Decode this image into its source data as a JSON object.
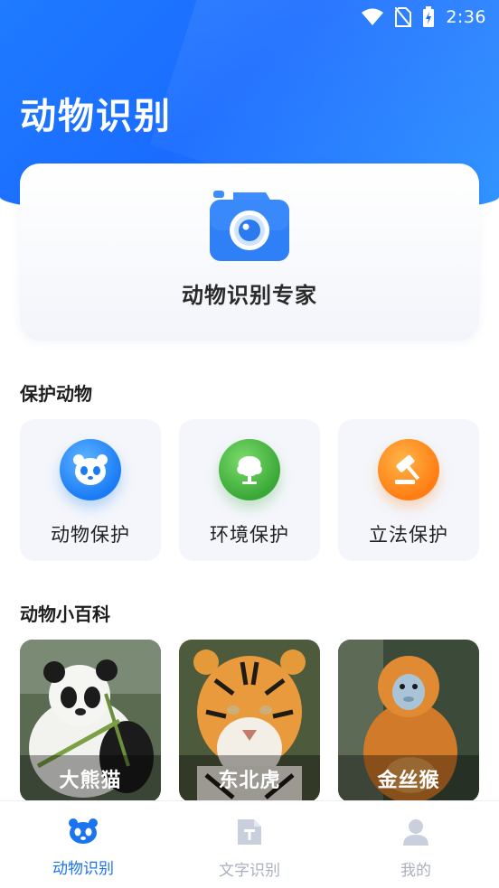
{
  "status_bar": {
    "time": "2:36",
    "icons": [
      "wifi-icon",
      "no-sim-icon",
      "battery-charging-icon"
    ]
  },
  "header": {
    "title": "动物识别"
  },
  "camera_card": {
    "label": "动物识别专家",
    "icon": "camera-icon"
  },
  "protect_section": {
    "title": "保护动物",
    "items": [
      {
        "label": "动物保护",
        "icon": "panda-icon",
        "color": "#1a7cf5"
      },
      {
        "label": "环境保护",
        "icon": "tree-icon",
        "color": "#3aa838"
      },
      {
        "label": "立法保护",
        "icon": "gavel-icon",
        "color": "#ff7d12"
      }
    ]
  },
  "wiki_section": {
    "title": "动物小百科",
    "items": [
      {
        "label": "大熊猫",
        "image": "panda-photo"
      },
      {
        "label": "东北虎",
        "image": "tiger-photo"
      },
      {
        "label": "金丝猴",
        "image": "golden-monkey-photo"
      }
    ]
  },
  "bottom_nav": {
    "items": [
      {
        "label": "动物识别",
        "icon": "panda-face-icon",
        "active": true
      },
      {
        "label": "文字识别",
        "icon": "text-doc-icon",
        "active": false
      },
      {
        "label": "我的",
        "icon": "person-icon",
        "active": false
      }
    ]
  },
  "colors": {
    "primary": "#1a73f0",
    "inactive": "#a9b0c0",
    "card_bg": "#f4f6fb"
  }
}
